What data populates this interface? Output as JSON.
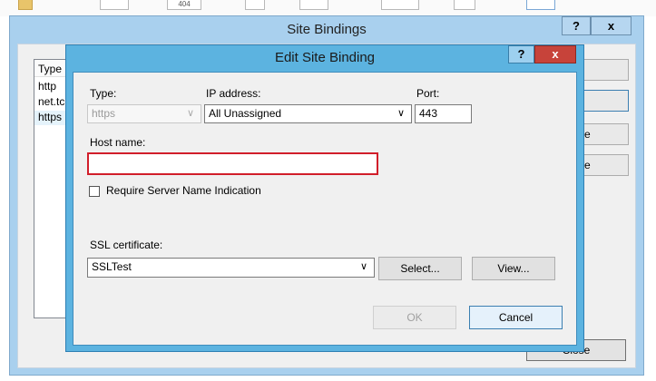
{
  "background": {
    "icon_label_404": "404"
  },
  "site_bindings": {
    "title": "Site Bindings",
    "help_label": "?",
    "close_glyph": "x",
    "list": {
      "header": "Type",
      "rows": [
        "http",
        "net.tc",
        "https"
      ]
    },
    "side_buttons": [
      "",
      "",
      "e",
      "e"
    ],
    "close_button": "Close"
  },
  "dialog": {
    "title": "Edit Site Binding",
    "help_label": "?",
    "close_glyph": "x",
    "type_label": "Type:",
    "type_value": "https",
    "ip_label": "IP address:",
    "ip_value": "All Unassigned",
    "port_label": "Port:",
    "port_value": "443",
    "host_label": "Host name:",
    "host_value": "",
    "sni_label": "Require Server Name Indication",
    "ssl_label": "SSL certificate:",
    "ssl_value": "SSLTest",
    "select_button": "Select...",
    "view_button": "View...",
    "ok_button": "OK",
    "cancel_button": "Cancel",
    "dropdown_glyph": "∨"
  },
  "colors": {
    "titlebar": "#a9d0ee",
    "dialog_frame": "#5cb3e0",
    "close_red": "#c7433a",
    "highlight_red": "#d11e2a"
  }
}
